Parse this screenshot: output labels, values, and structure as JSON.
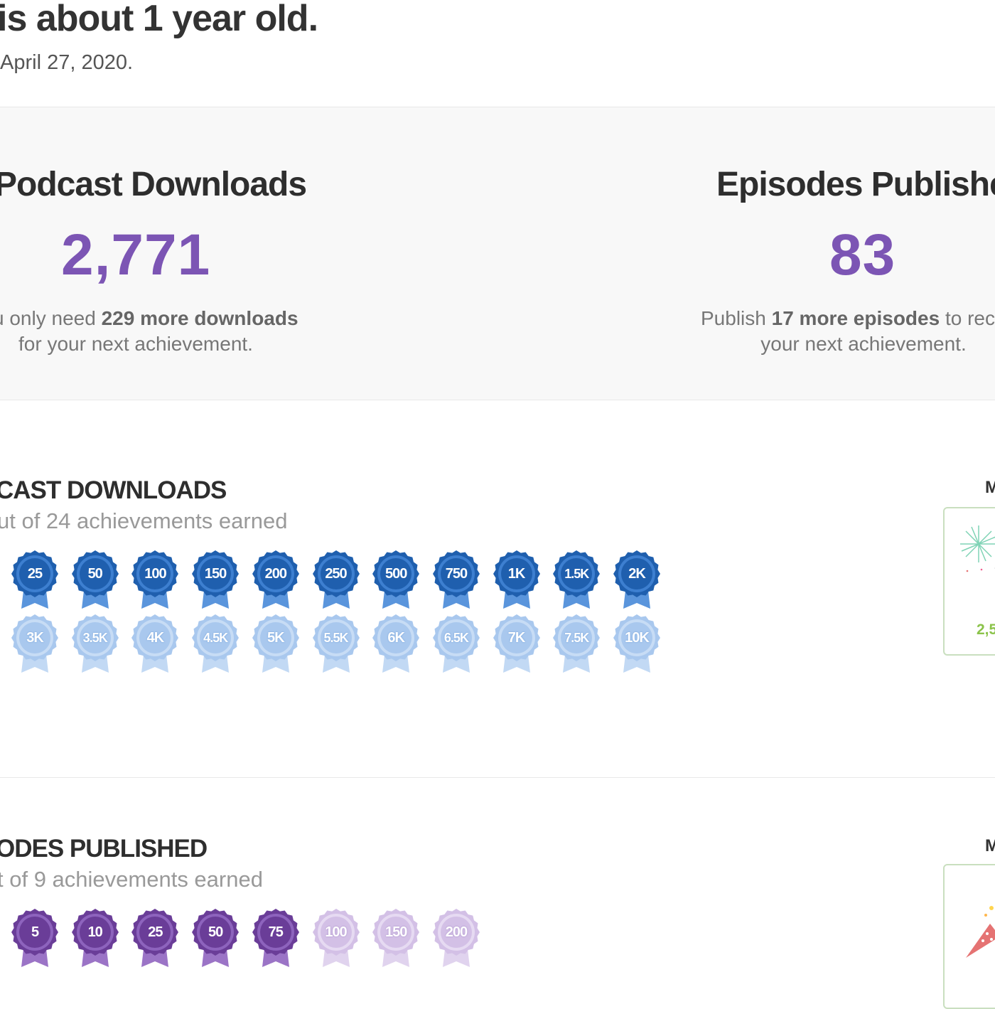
{
  "header": {
    "title": "is about 1 year old.",
    "subtitle": "April 27, 2020."
  },
  "stats": {
    "downloads": {
      "title": "Podcast Downloads",
      "value": "2,771",
      "note_pre": "u only need ",
      "note_bold": "229 more downloads",
      "note_line2": "for your next achievement."
    },
    "episodes": {
      "title": "Episodes Publishe",
      "value": "83",
      "note_pre": "Publish ",
      "note_bold": "17 more episodes",
      "note_post": " to rece",
      "note_line2": "your next achievement."
    }
  },
  "downloads_section": {
    "title": "CAST DOWNLOADS",
    "subtitle": "ut of 24 achievements earned",
    "earned_badges": [
      "25",
      "50",
      "100",
      "150",
      "200",
      "250",
      "500",
      "750",
      "1K",
      "1.5K",
      "2K"
    ],
    "locked_badges": [
      "3K",
      "3.5K",
      "4K",
      "4.5K",
      "5K",
      "5.5K",
      "6K",
      "6.5K",
      "7K",
      "7.5K",
      "10K"
    ],
    "side_label": "M",
    "side_card_value": "2,5"
  },
  "episodes_section": {
    "title": "ODES PUBLISHED",
    "subtitle": "t of 9 achievements earned",
    "earned_badges": [
      "5",
      "10",
      "25",
      "50",
      "75"
    ],
    "locked_badges": [
      "100",
      "150",
      "200"
    ],
    "side_label": "M"
  },
  "colors": {
    "accent_purple": "#7c55b4",
    "badge_blue_earned": "#1f5fae",
    "badge_blue_locked": "#a9c8ee",
    "badge_purple_earned": "#6a3d98",
    "badge_purple_locked": "#d3c0e6",
    "card_green": "#8bc34a"
  }
}
